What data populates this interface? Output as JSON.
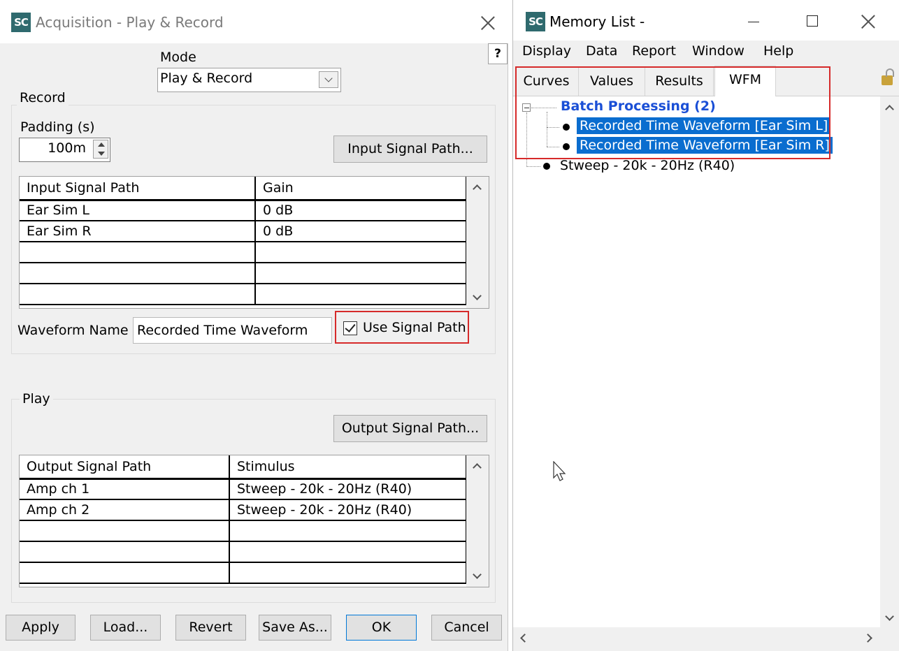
{
  "acquisition_window": {
    "logo": "SC",
    "title": "Acquisition  - Play & Record",
    "help_label": "?",
    "mode": {
      "label": "Mode",
      "selected": "Play & Record"
    },
    "record": {
      "group_title": "Record",
      "padding_label": "Padding (s)",
      "padding_value": "100m",
      "input_signal_path_button": "Input Signal Path...",
      "table": {
        "headers": [
          "Input Signal Path",
          "Gain"
        ],
        "rows": [
          [
            "Ear Sim L",
            "0 dB"
          ],
          [
            "Ear Sim R",
            "0 dB"
          ],
          [
            "",
            ""
          ],
          [
            "",
            ""
          ],
          [
            "",
            ""
          ]
        ]
      },
      "waveform_name_label": "Waveform Name",
      "waveform_name_value": "Recorded Time Waveform",
      "use_signal_path_label": "Use Signal Path",
      "use_signal_path_checked": true
    },
    "play": {
      "group_title": "Play",
      "output_signal_path_button": "Output Signal Path...",
      "table": {
        "headers": [
          "Output Signal Path",
          "Stimulus"
        ],
        "rows": [
          [
            "Amp ch 1",
            "Stweep - 20k - 20Hz (R40)"
          ],
          [
            "Amp ch 2",
            "Stweep - 20k - 20Hz (R40)"
          ],
          [
            "",
            ""
          ],
          [
            "",
            ""
          ],
          [
            "",
            ""
          ]
        ]
      }
    },
    "buttons": {
      "apply": "Apply",
      "load": "Load...",
      "revert": "Revert",
      "save_as": "Save As...",
      "ok": "OK",
      "cancel": "Cancel"
    }
  },
  "memory_window": {
    "logo": "SC",
    "title": "Memory List -",
    "menu": [
      "Display",
      "Data",
      "Report",
      "Window",
      "Help"
    ],
    "tabs": [
      "Curves",
      "Values",
      "Results",
      "WFM"
    ],
    "active_tab": "WFM",
    "tree": {
      "group_label": "Batch Processing (2)",
      "group_children": [
        "Recorded Time Waveform [Ear Sim L]",
        "Recorded Time Waveform [Ear Sim R]"
      ],
      "other_item": "Stweep - 20k - 20Hz (R40)"
    }
  },
  "colors": {
    "highlight_red": "#d62a2a",
    "selection_blue": "#0a6dcf",
    "group_label_blue": "#1a4fd6",
    "logo_teal": "#2f6a6e"
  }
}
